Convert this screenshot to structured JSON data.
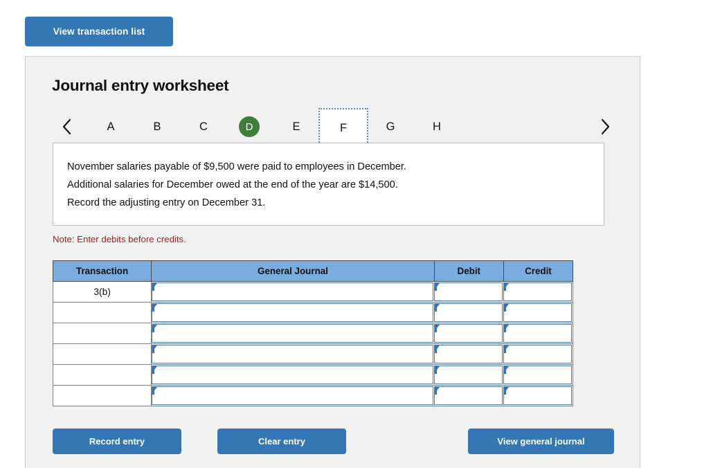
{
  "top": {
    "view_transaction_list": "View transaction list"
  },
  "panel": {
    "title": "Journal entry worksheet",
    "nav": {
      "prev_icon": "chevron-left-icon",
      "next_icon": "chevron-right-icon"
    },
    "tabs": [
      {
        "label": "A",
        "state": "normal"
      },
      {
        "label": "B",
        "state": "normal"
      },
      {
        "label": "C",
        "state": "normal"
      },
      {
        "label": "D",
        "state": "current"
      },
      {
        "label": "E",
        "state": "normal"
      },
      {
        "label": "F",
        "state": "focused"
      },
      {
        "label": "G",
        "state": "normal"
      },
      {
        "label": "H",
        "state": "normal"
      }
    ],
    "instruction": "November salaries payable of $9,500 were paid to employees in December.\nAdditional salaries for December owed at the end of the year are $14,500.\nRecord the adjusting entry on December 31.",
    "note": "Note: Enter debits before credits.",
    "table": {
      "headers": {
        "transaction": "Transaction",
        "general_journal": "General Journal",
        "debit": "Debit",
        "credit": "Credit"
      },
      "rows": [
        {
          "transaction": "3(b)",
          "general_journal": "",
          "debit": "",
          "credit": ""
        },
        {
          "transaction": "",
          "general_journal": "",
          "debit": "",
          "credit": ""
        },
        {
          "transaction": "",
          "general_journal": "",
          "debit": "",
          "credit": ""
        },
        {
          "transaction": "",
          "general_journal": "",
          "debit": "",
          "credit": ""
        },
        {
          "transaction": "",
          "general_journal": "",
          "debit": "",
          "credit": ""
        },
        {
          "transaction": "",
          "general_journal": "",
          "debit": "",
          "credit": ""
        }
      ]
    },
    "footer": {
      "record_entry": "Record entry",
      "clear_entry": "Clear entry",
      "view_general_journal": "View general journal"
    }
  },
  "colors": {
    "button_blue": "#3577b5",
    "header_blue": "#7bacdf",
    "current_tab_green": "#3e7d3a",
    "note_red": "#a02020",
    "input_border_blue": "#4a7ebb",
    "panel_bg": "#f1f1f1"
  }
}
